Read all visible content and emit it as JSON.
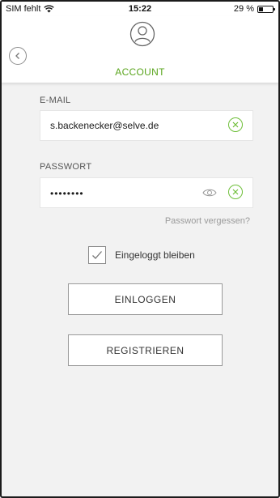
{
  "status_bar": {
    "carrier": "SIM fehlt",
    "time": "15:22",
    "battery": "29 %"
  },
  "header": {
    "title": "ACCOUNT",
    "icons": [
      "back-icon",
      "account-icon"
    ]
  },
  "form": {
    "email": {
      "label": "E-MAIL",
      "value": "s.backenecker@selve.de"
    },
    "password": {
      "label": "PASSWORT",
      "value": "••••••••"
    },
    "forgot_link": "Passwort vergessen?",
    "remember": {
      "label": "Eingeloggt bleiben",
      "checked": true
    },
    "login_button": "EINLOGGEN",
    "register_button": "REGISTRIEREN"
  },
  "colors": {
    "accent": "#5aa51d",
    "background": "#f2f2f2"
  }
}
